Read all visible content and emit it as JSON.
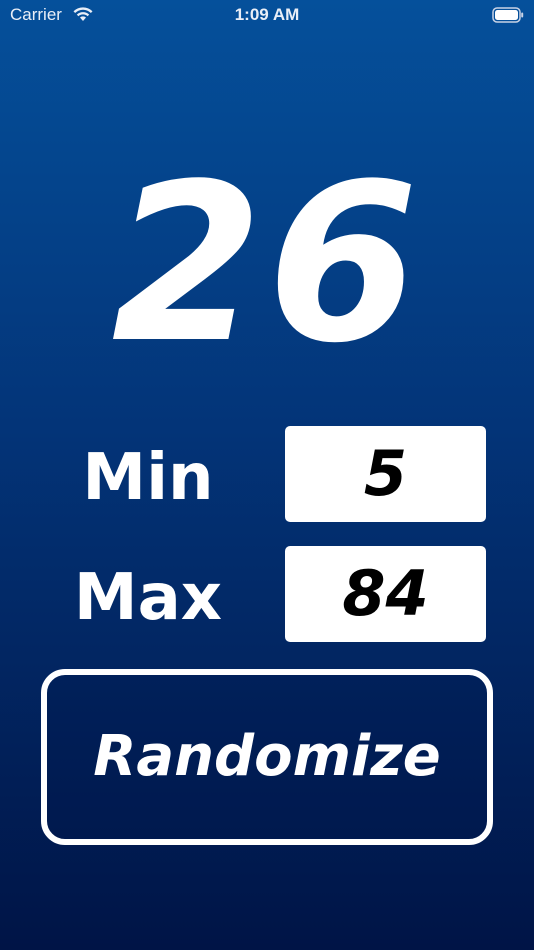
{
  "status_bar": {
    "carrier": "Carrier",
    "time": "1:09 AM",
    "wifi_icon": "wifi-icon",
    "battery_icon": "battery-icon"
  },
  "result": {
    "value": "26"
  },
  "range": {
    "min_label": "Min",
    "min_value": "5",
    "max_label": "Max",
    "max_value": "84"
  },
  "randomize_button": {
    "label": "Randomize"
  },
  "colors": {
    "background_top": "#05509b",
    "background_bottom": "#001446",
    "text": "#ffffff",
    "field_background": "#ffffff",
    "field_text": "#000000"
  }
}
